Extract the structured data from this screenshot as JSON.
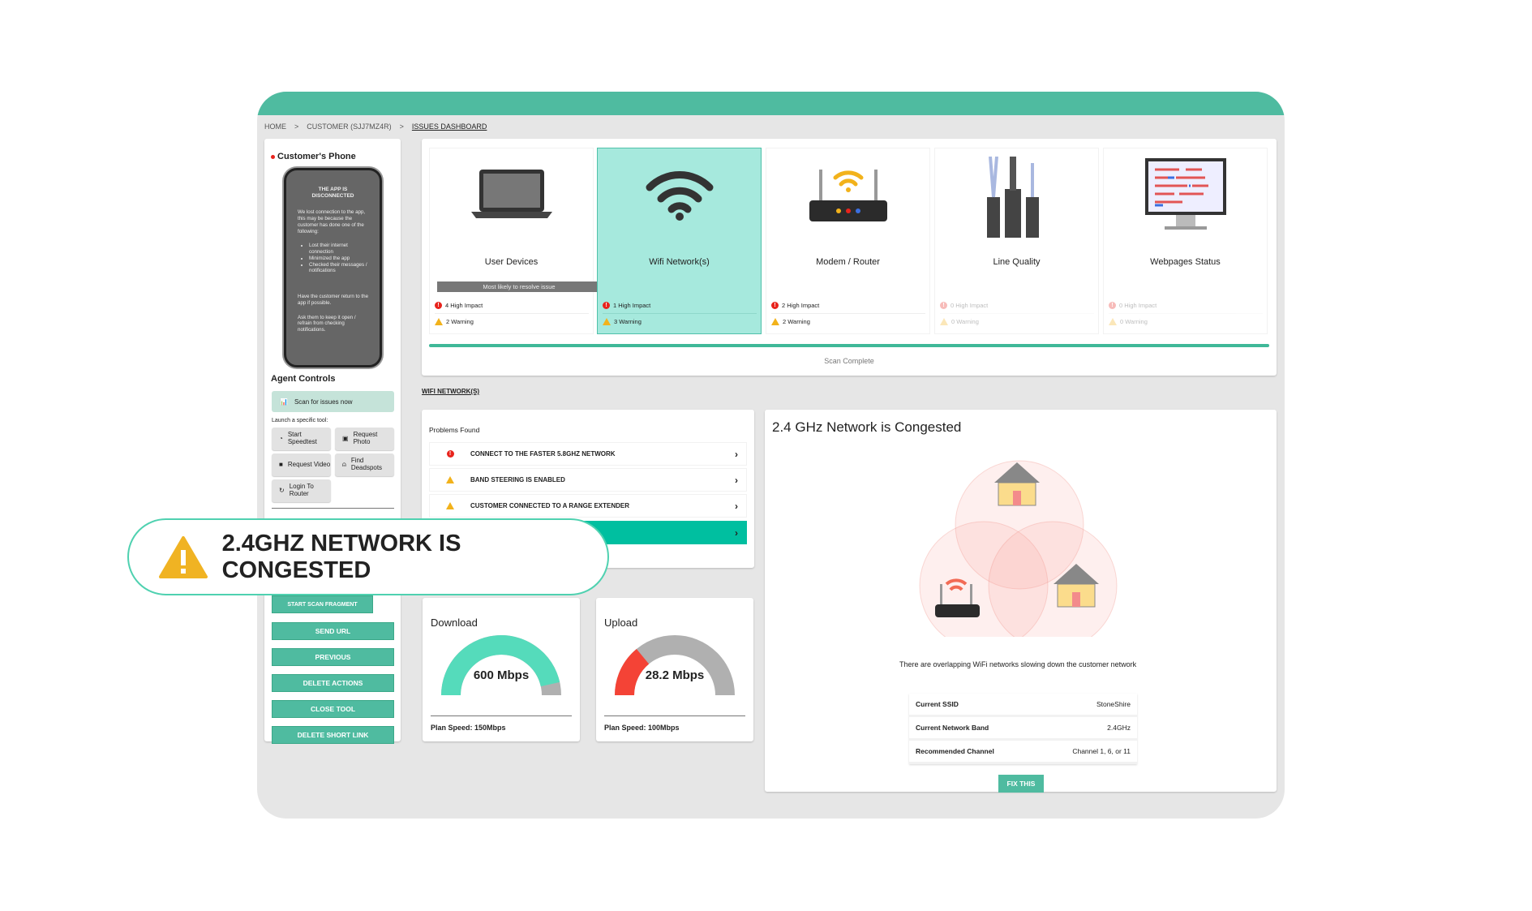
{
  "breadcrumb": [
    "HOME",
    "CUSTOMER (SJJ7MZ4R)",
    "ISSUES DASHBOARD"
  ],
  "phone": {
    "title": "Customer's Phone",
    "heading": "THE APP IS DISCONNECTED",
    "intro": "We lost connection to the app, this may be because the customer has done one of the following:",
    "reasons": [
      "Lost their internet connection",
      "Minimized the app",
      "Checked their messages / notifications"
    ],
    "p1": "Have the customer return to the app if possible.",
    "p2": "Ask them to keep it open / refrain from checking notifications."
  },
  "agent": {
    "title": "Agent Controls",
    "scan": "Scan for issues now",
    "launch": "Launch a specific tool:",
    "tools": [
      {
        "label": "Start Speedtest",
        "icon": "speedometer-icon"
      },
      {
        "label": "Request Photo",
        "icon": "camera-icon"
      },
      {
        "label": "Request Video",
        "icon": "video-icon"
      },
      {
        "label": "Find Deadspots",
        "icon": "antenna-icon"
      },
      {
        "label": "Login To Router",
        "icon": "router-login-icon"
      }
    ],
    "buttons": [
      "START SCAN FRAGMENT",
      "SEND URL",
      "PREVIOUS",
      "DELETE ACTIONS",
      "CLOSE TOOL",
      "DELETE SHORT LINK"
    ]
  },
  "categories": [
    {
      "label": "User Devices",
      "high": "4 High Impact",
      "warn": "2 Warning",
      "badge": "Most likely to resolve issue"
    },
    {
      "label": "Wifi Network(s)",
      "high": "1 High Impact",
      "warn": "3 Warning",
      "selected": true
    },
    {
      "label": "Modem / Router",
      "high": "2 High Impact",
      "warn": "2 Warning"
    },
    {
      "label": "Line Quality",
      "high": "0 High Impact",
      "warn": "0 Warning"
    },
    {
      "label": "Webpages Status",
      "high": "0 High Impact",
      "warn": "0 Warning"
    }
  ],
  "scan": {
    "status": "Scan Complete",
    "progress": 100
  },
  "section": "WIFI NETWORK(S)",
  "problems": {
    "title": "Problems Found",
    "items": [
      {
        "label": "CONNECT TO THE FASTER 5.8GHZ NETWORK",
        "level": "high"
      },
      {
        "label": "BAND STEERING IS ENABLED",
        "level": "warning"
      },
      {
        "label": "CUSTOMER CONNECTED TO A RANGE EXTENDER",
        "level": "warning"
      },
      {
        "label": "",
        "level": "selected"
      }
    ]
  },
  "detail": {
    "title": "2.4 GHz Network is Congested",
    "desc": "There are overlapping WiFi networks slowing down the customer network",
    "rows": [
      [
        "Current SSID",
        "StoneShire"
      ],
      [
        "Current Network Band",
        "2.4GHz"
      ],
      [
        "Recommended Channel",
        "Channel 1, 6, or 11"
      ]
    ],
    "button": "FIX THIS"
  },
  "download": {
    "title": "Download",
    "value": "600 Mbps",
    "plan": "Plan Speed: 150Mbps",
    "fill": 0.93,
    "color": "#55dbbb"
  },
  "upload": {
    "title": "Upload",
    "value": "28.2 Mbps",
    "plan": "Plan Speed: 100Mbps",
    "fill": 0.28,
    "color": "#f44336"
  },
  "callout": {
    "text": "2.4GHZ NETWORK IS CONGESTED"
  },
  "colors": {
    "accent": "#4fbba0",
    "selected": "#a6e9dd",
    "high": "#e8231c",
    "warning": "#f2b21b"
  }
}
